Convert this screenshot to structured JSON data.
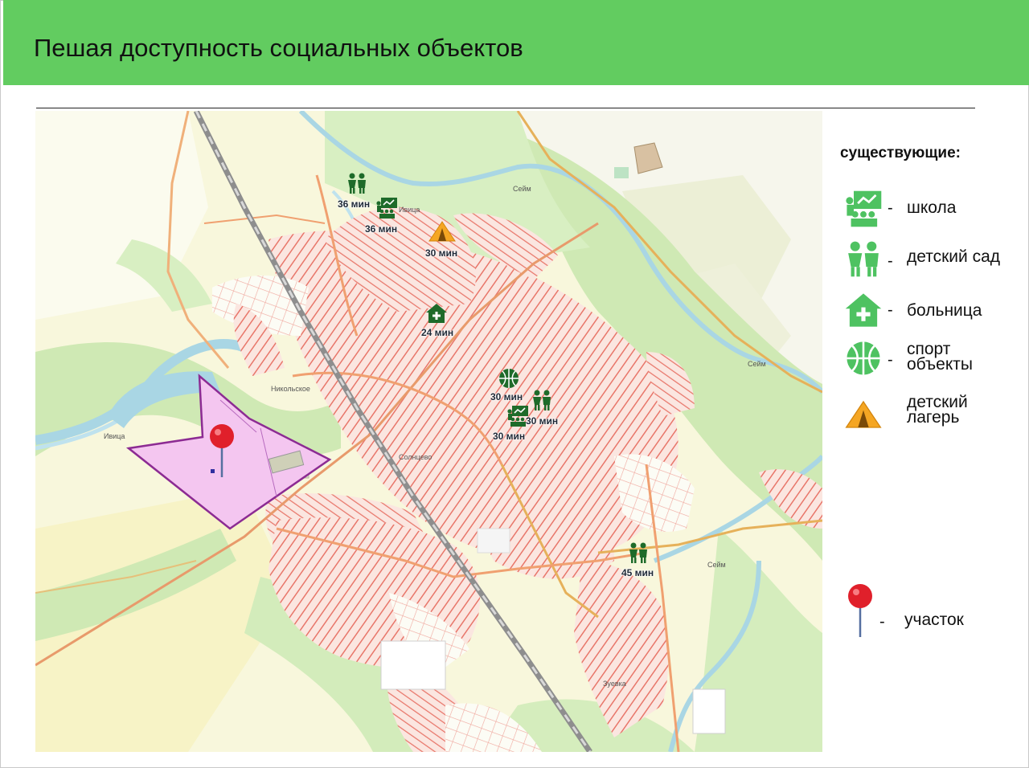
{
  "header": {
    "title": "Пешая доступность социальных объектов"
  },
  "colors": {
    "header_bg": "#62cc60",
    "icon_map": "#1e6b2a",
    "icon_legend": "#4ec261",
    "camp": "#f5a623",
    "plot": "#f4c6f0",
    "plot_border": "#8c2b93",
    "pin": "#e0202b"
  },
  "map": {
    "places": {
      "nikolskoe": "Никольское",
      "soltsevo": "Солнцево",
      "zuevka": "Зуевка",
      "ivitsa_1": "Ивица",
      "ivitsa_2": "Ивица",
      "seim_1": "Сейм",
      "seim_2": "Сейм",
      "seim_3": "Сейм"
    },
    "markers": [
      {
        "icon": "kindergarten-icon",
        "label": "36 мин"
      },
      {
        "icon": "school-icon",
        "label": "36 мин"
      },
      {
        "icon": "camp-icon",
        "label": "30 мин"
      },
      {
        "icon": "hospital-icon",
        "label": "24 мин"
      },
      {
        "icon": "sport-icon",
        "label": "30 мин"
      },
      {
        "icon": "kindergarten-icon",
        "label": "30 мин"
      },
      {
        "icon": "school-icon",
        "label": "30 мин"
      },
      {
        "icon": "kindergarten-icon",
        "label": "45 мин"
      }
    ]
  },
  "legend": {
    "heading": "существующие:",
    "dash": "-",
    "items": [
      {
        "icon": "school-icon",
        "line1": "школа",
        "line2": ""
      },
      {
        "icon": "kindergarten-icon",
        "line1": "детский сад",
        "line2": ""
      },
      {
        "icon": "hospital-icon",
        "line1": "больница",
        "line2": ""
      },
      {
        "icon": "sport-icon",
        "line1": "спорт",
        "line2": "объекты"
      },
      {
        "icon": "camp-icon",
        "line1": "детский",
        "line2": "лагерь"
      }
    ],
    "plot": {
      "icon": "pin-icon",
      "label": "участок"
    }
  }
}
